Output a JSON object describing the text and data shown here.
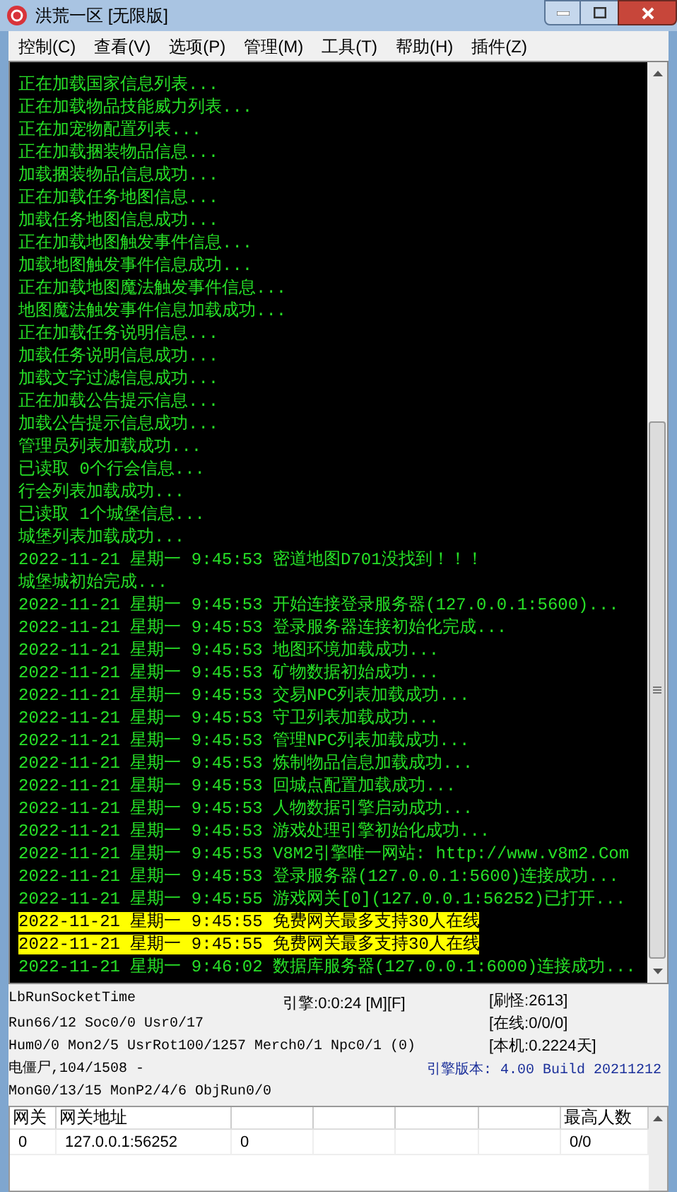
{
  "window": {
    "title": "洪荒一区 [无限版]"
  },
  "menu": [
    "控制(C)",
    "查看(V)",
    "选项(P)",
    "管理(M)",
    "工具(T)",
    "帮助(H)",
    "插件(Z)"
  ],
  "log": [
    {
      "text": "正在加载国家信息列表...",
      "highlighted": false
    },
    {
      "text": "正在加载物品技能威力列表...",
      "highlighted": false
    },
    {
      "text": "正在加宠物配置列表...",
      "highlighted": false
    },
    {
      "text": "正在加载捆装物品信息...",
      "highlighted": false
    },
    {
      "text": "加载捆装物品信息成功...",
      "highlighted": false
    },
    {
      "text": "正在加载任务地图信息...",
      "highlighted": false
    },
    {
      "text": "加载任务地图信息成功...",
      "highlighted": false
    },
    {
      "text": "正在加载地图触发事件信息...",
      "highlighted": false
    },
    {
      "text": "加载地图触发事件信息成功...",
      "highlighted": false
    },
    {
      "text": "正在加载地图魔法触发事件信息...",
      "highlighted": false
    },
    {
      "text": "地图魔法触发事件信息加载成功...",
      "highlighted": false
    },
    {
      "text": "正在加载任务说明信息...",
      "highlighted": false
    },
    {
      "text": "加载任务说明信息成功...",
      "highlighted": false
    },
    {
      "text": "加载文字过滤信息成功...",
      "highlighted": false
    },
    {
      "text": "正在加载公告提示信息...",
      "highlighted": false
    },
    {
      "text": "加载公告提示信息成功...",
      "highlighted": false
    },
    {
      "text": "管理员列表加载成功...",
      "highlighted": false
    },
    {
      "text": "已读取 0个行会信息...",
      "highlighted": false
    },
    {
      "text": "行会列表加载成功...",
      "highlighted": false
    },
    {
      "text": "已读取 1个城堡信息...",
      "highlighted": false
    },
    {
      "text": "城堡列表加载成功...",
      "highlighted": false
    },
    {
      "text": "2022-11-21 星期一 9:45:53 密道地图D701没找到！！！",
      "highlighted": false
    },
    {
      "text": "城堡城初始完成...",
      "highlighted": false
    },
    {
      "text": "2022-11-21 星期一 9:45:53 开始连接登录服务器(127.0.0.1:5600)...",
      "highlighted": false
    },
    {
      "text": "2022-11-21 星期一 9:45:53 登录服务器连接初始化完成...",
      "highlighted": false
    },
    {
      "text": "2022-11-21 星期一 9:45:53 地图环境加载成功...",
      "highlighted": false
    },
    {
      "text": "2022-11-21 星期一 9:45:53 矿物数据初始成功...",
      "highlighted": false
    },
    {
      "text": "2022-11-21 星期一 9:45:53 交易NPC列表加载成功...",
      "highlighted": false
    },
    {
      "text": "2022-11-21 星期一 9:45:53 守卫列表加载成功...",
      "highlighted": false
    },
    {
      "text": "2022-11-21 星期一 9:45:53 管理NPC列表加载成功...",
      "highlighted": false
    },
    {
      "text": "2022-11-21 星期一 9:45:53 炼制物品信息加载成功...",
      "highlighted": false
    },
    {
      "text": "2022-11-21 星期一 9:45:53 回城点配置加载成功...",
      "highlighted": false
    },
    {
      "text": "2022-11-21 星期一 9:45:53 人物数据引擎启动成功...",
      "highlighted": false
    },
    {
      "text": "2022-11-21 星期一 9:45:53 游戏处理引擎初始化成功...",
      "highlighted": false
    },
    {
      "text": "2022-11-21 星期一 9:45:53 V8M2引擎唯一网站: http://www.v8m2.Com",
      "highlighted": false
    },
    {
      "text": "2022-11-21 星期一 9:45:53 登录服务器(127.0.0.1:5600)连接成功...",
      "highlighted": false
    },
    {
      "text": "2022-11-21 星期一 9:45:55 游戏网关[0](127.0.0.1:56252)已打开...",
      "highlighted": false
    },
    {
      "text": "2022-11-21 星期一 9:45:55 免费网关最多支持30人在线",
      "highlighted": true
    },
    {
      "text": "2022-11-21 星期一 9:45:55 免费网关最多支持30人在线",
      "highlighted": true
    },
    {
      "text": "2022-11-21 星期一 9:46:02 数据库服务器(127.0.0.1:6000)连接成功...",
      "highlighted": false
    }
  ],
  "status": {
    "left": [
      "LbRunSocketTime",
      "Run66/12 Soc0/0 Usr0/17",
      "Hum0/0 Mon2/5 UsrRot100/1257 Merch0/1 Npc0/1 (0)",
      "电僵尸,104/1508 -",
      "MonG0/13/15 MonP2/4/6 ObjRun0/0"
    ],
    "engine_time": "引擎:0:0:24 [M][F]",
    "right": [
      "[刷怪:2613]",
      "[在线:0/0/0]",
      "[本机:0.2224天]"
    ],
    "version": "引擎版本: 4.00 Build 20211212"
  },
  "table": {
    "columns": [
      "网关",
      "网关地址",
      "",
      "",
      "",
      "",
      "最高人数"
    ],
    "rows": [
      [
        "0",
        "127.0.0.1:56252",
        "0",
        "",
        "",
        "",
        "0/0"
      ]
    ]
  }
}
